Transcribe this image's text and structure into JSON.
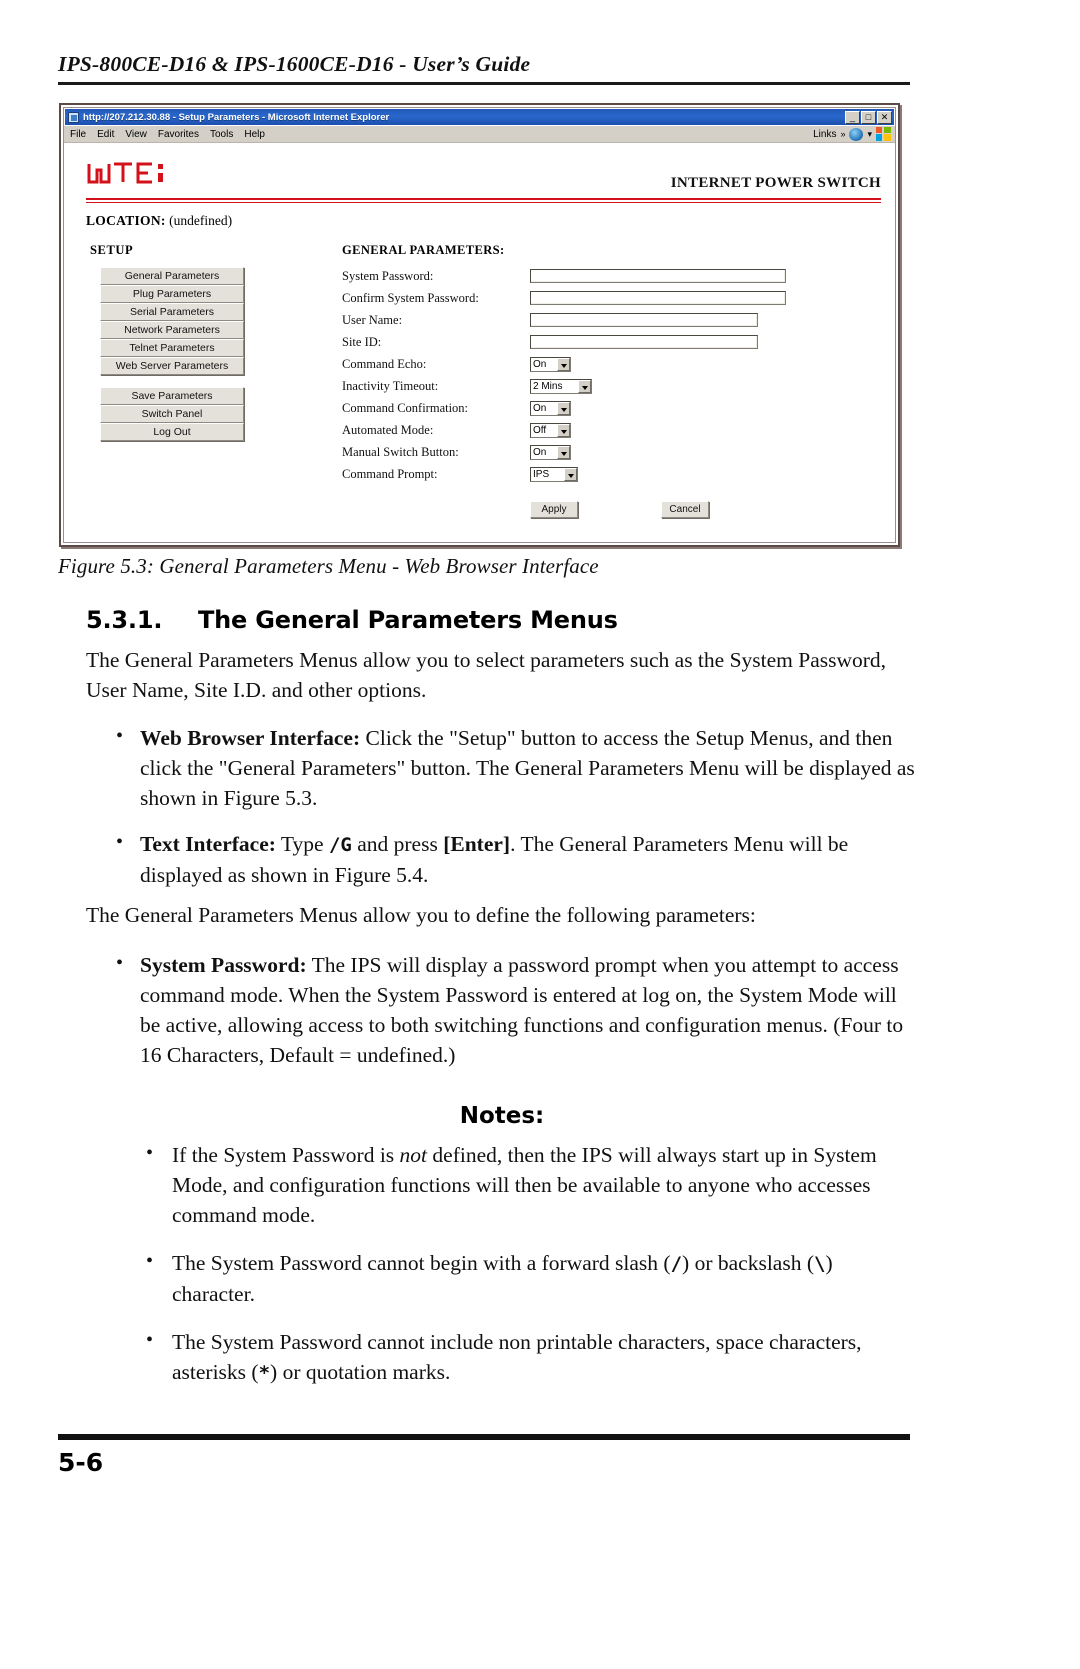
{
  "running_head": "IPS-800CE-D16 & IPS-1600CE-D16 - User’s Guide",
  "browser": {
    "title": "http://207.212.30.88 - Setup Parameters - Microsoft Internet Explorer",
    "window_buttons": {
      "minimize": "_",
      "maximize": "□",
      "close": "✕"
    },
    "menus": [
      "File",
      "Edit",
      "View",
      "Favorites",
      "Tools",
      "Help"
    ],
    "links_label": "Links",
    "links_chevron": "»"
  },
  "app": {
    "logo_text": "wti",
    "header_title": "INTERNET POWER SWITCH",
    "location_label": "LOCATION:",
    "location_value": "(undefined)",
    "setup_label": "SETUP",
    "nav_group_1": [
      "General Parameters",
      "Plug Parameters",
      "Serial Parameters",
      "Network Parameters",
      "Telnet Parameters",
      "Web Server Parameters"
    ],
    "nav_group_2": [
      "Save Parameters",
      "Switch Panel",
      "Log Out"
    ],
    "form_title": "GENERAL PARAMETERS:",
    "fields": [
      {
        "label": "System Password:",
        "type": "text",
        "value": ""
      },
      {
        "label": "Confirm System Password:",
        "type": "text",
        "value": ""
      },
      {
        "label": "User Name:",
        "type": "text",
        "value": ""
      },
      {
        "label": "Site ID:",
        "type": "text",
        "value": ""
      },
      {
        "label": "Command Echo:",
        "type": "select",
        "value": "On"
      },
      {
        "label": "Inactivity Timeout:",
        "type": "select",
        "value": "2 Mins"
      },
      {
        "label": "Command Confirmation:",
        "type": "select",
        "value": "On"
      },
      {
        "label": "Automated Mode:",
        "type": "select",
        "value": "Off"
      },
      {
        "label": "Manual Switch Button:",
        "type": "select",
        "value": "On"
      },
      {
        "label": "Command Prompt:",
        "type": "select",
        "value": "IPS"
      }
    ],
    "apply_label": "Apply",
    "cancel_label": "Cancel"
  },
  "figure_caption": "Figure 5.3:  General Parameters Menu - Web Browser Interface",
  "section": {
    "number": "5.3.1.",
    "title": "The General Parameters Menus",
    "intro": "The General Parameters Menus allow you to select parameters such as the System Password, User Name, Site I.D. and other options.",
    "bullets_interface": [
      {
        "lead": "Web Browser Interface:",
        "text": "  Click the \"Setup\" button to access the Setup Menus, and then click the \"General Parameters\" button.  The General Parameters Menu will be displayed as shown in Figure 5.3."
      },
      {
        "lead": "Text Interface:",
        "text_pre": "  Type ",
        "code": "/G",
        "text_mid": " and press ",
        "bold2": "[Enter]",
        "text_post": ".  The General Parameters Menu will be displayed as shown in Figure 5.4."
      }
    ],
    "paragraph_2": "The General Parameters Menus allow you to define the following parameters:",
    "bullets_params": [
      {
        "lead": "System Password:",
        "text": "  The IPS will display a password prompt when you attempt to access command mode.  When the System Password is entered at log on, the System Mode will be active, allowing access to both switching functions and configuration menus.  (Four to 16 Characters, Default = undefined.)"
      }
    ],
    "notes_heading": "Notes:",
    "notes": [
      {
        "pre": "If the System Password is ",
        "em": "not",
        "post": " defined, then the IPS will always start up in System Mode, and configuration functions will then be available to anyone who accesses command mode."
      },
      {
        "pre": "The System Password cannot begin with a forward slash (",
        "code1": "/",
        "mid": ") or backslash (",
        "code2": "\\",
        "post": ") character."
      },
      {
        "pre": "The System Password cannot include non printable characters, space characters, asterisks (",
        "code1": "*",
        "post": ") or quotation marks."
      }
    ]
  },
  "footer": {
    "page_number": "5-6"
  },
  "colors": {
    "title_bar": "#2158b8",
    "brand_red": "#d3111b",
    "button_face": "#e4e1da",
    "frame": "#5d4a47"
  }
}
